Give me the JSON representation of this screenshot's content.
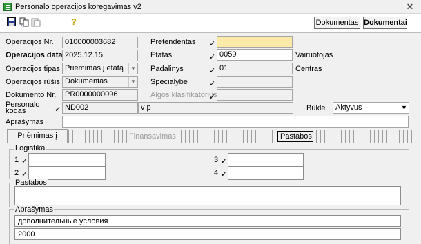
{
  "window": {
    "title": "Personalo operacijos koregavimas v2",
    "close_glyph": "✕"
  },
  "toolbar": {
    "btn_documents": "Dokumentas",
    "btn_documents2": "Dokumentai"
  },
  "icons": {
    "save": "floppy-icon",
    "copy": "copy-icon",
    "help": "help-icon"
  },
  "form": {
    "operation_no_label": "Operacijos Nr.",
    "operation_no": "010000003682",
    "operation_date_label": "Operacijos data",
    "operation_date": "2025.12.15",
    "operation_type_label": "Operacijos tipas",
    "operation_type": "Priėmimas į etatą",
    "operation_kind_label": "Operacijos rūšis",
    "operation_kind": "Dokumentas",
    "document_no_label": "Dokumento Nr.",
    "document_no": "PR0000000096",
    "personal_code_label_1": "Personalo",
    "personal_code_label_2": "kodas",
    "personal_code": "ND002",
    "person_name": "v p",
    "description_label": "Aprašymas",
    "description": "",
    "candidate_label": "Pretendentas",
    "candidate": "",
    "position_label": "Etatas",
    "position": "0059",
    "position_name": "Vairuotojas",
    "department_label": "Padalinys",
    "department": "01",
    "department_name": "Centras",
    "specialty_label": "Specialybė",
    "specialty": "",
    "salary_class_label": "Algos klasifikatorius",
    "salary_class": "",
    "status_label": "Būklė",
    "status": "Aktyvus",
    "check": "✓"
  },
  "tabs": {
    "tab1": "Priėmimas į etatą",
    "tab_finance": "Finansavimas",
    "tab_notes": "Pastabos"
  },
  "pane": {
    "logistics_label": "Logistika",
    "n1": "1",
    "n2": "2",
    "n3": "3",
    "n4": "4",
    "notes_label": "Pastabos",
    "description_label": "Aprašymas",
    "desc_line1": "дополнительные условия",
    "desc_line2": "2000"
  },
  "colors": {
    "yellow_field": "#fde9a8",
    "app_icon": "#2e9d3a"
  }
}
